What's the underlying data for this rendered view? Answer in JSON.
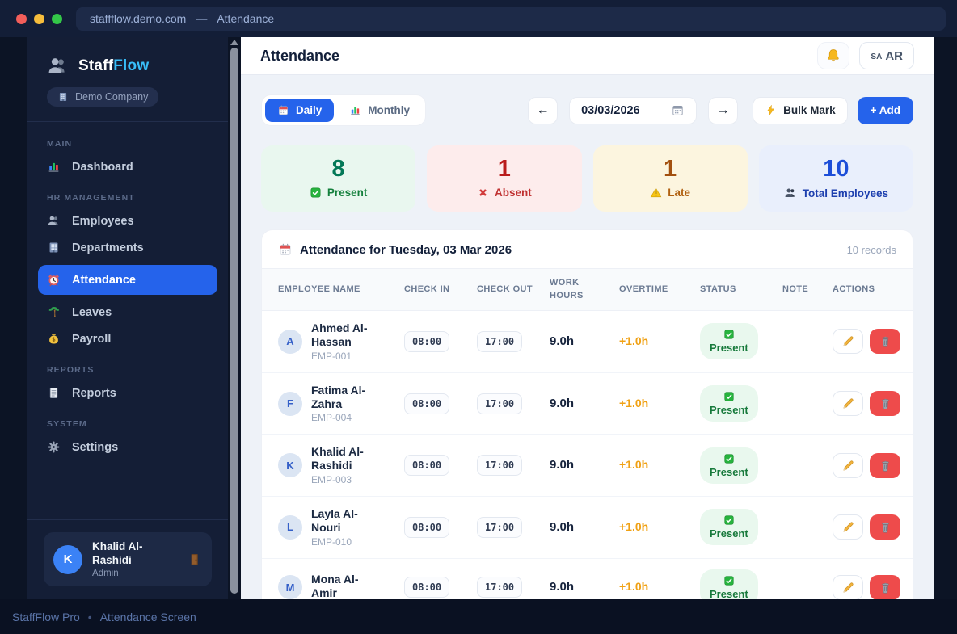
{
  "browser": {
    "url": "staffflow.demo.com",
    "separator": "—",
    "page_title": "Attendance"
  },
  "sidebar": {
    "brand": {
      "first": "Staff",
      "second": "Flow"
    },
    "company_badge": "Demo Company",
    "sections": [
      {
        "label": "MAIN",
        "items": [
          {
            "label": "Dashboard",
            "icon": "bar-chart-icon",
            "active": false
          }
        ]
      },
      {
        "label": "HR MANAGEMENT",
        "items": [
          {
            "label": "Employees",
            "icon": "people-icon",
            "active": false
          },
          {
            "label": "Departments",
            "icon": "building-icon",
            "active": false
          },
          {
            "label": "Attendance",
            "icon": "alarm-clock-icon",
            "active": true
          },
          {
            "label": "Leaves",
            "icon": "palm-tree-icon",
            "active": false
          },
          {
            "label": "Payroll",
            "icon": "money-bag-icon",
            "active": false
          }
        ]
      },
      {
        "label": "REPORTS",
        "items": [
          {
            "label": "Reports",
            "icon": "document-icon",
            "active": false
          }
        ]
      },
      {
        "label": "SYSTEM",
        "items": [
          {
            "label": "Settings",
            "icon": "gear-icon",
            "active": false
          }
        ]
      }
    ],
    "user": {
      "initial": "K",
      "name": "Khalid Al-Rashidi",
      "role": "Admin",
      "logout_icon": "door-icon"
    }
  },
  "header": {
    "title": "Attendance",
    "lang_small": "SA",
    "lang_large": "AR"
  },
  "toolbar": {
    "daily_label": "Daily",
    "monthly_label": "Monthly",
    "prev_label": "←",
    "date_value": "03/03/2026",
    "next_label": "→",
    "bulk_label": "Bulk Mark",
    "add_label": "+ Add"
  },
  "stats": [
    {
      "value": "8",
      "label": "Present",
      "icon": "green-check-icon",
      "bg": "#e9f7ef",
      "value_color": "#047857"
    },
    {
      "value": "1",
      "label": "Absent",
      "icon": "red-x-icon",
      "bg": "#fdecec",
      "value_color": "#b91c1c"
    },
    {
      "value": "1",
      "label": "Late",
      "icon": "warning-icon",
      "bg": "#fcf5df",
      "value_color": "#a2500f"
    },
    {
      "value": "10",
      "label": "Total Employees",
      "icon": "people-icon",
      "bg": "#e9effc",
      "value_color": "#1d4ed8"
    }
  ],
  "table": {
    "title": "Attendance for Tuesday, 03 Mar 2026",
    "records_label": "10 records",
    "columns": [
      "EMPLOYEE NAME",
      "CHECK IN",
      "CHECK OUT",
      "WORK HOURS",
      "OVERTIME",
      "STATUS",
      "NOTE",
      "ACTIONS"
    ],
    "rows": [
      {
        "initial": "A",
        "name": "Ahmed Al-Hassan",
        "emp_id": "EMP-001",
        "check_in": "08:00",
        "check_out": "17:00",
        "work_hours": "9.0h",
        "overtime": "+1.0h",
        "status": "Present",
        "note": ""
      },
      {
        "initial": "F",
        "name": "Fatima Al-Zahra",
        "emp_id": "EMP-004",
        "check_in": "08:00",
        "check_out": "17:00",
        "work_hours": "9.0h",
        "overtime": "+1.0h",
        "status": "Present",
        "note": ""
      },
      {
        "initial": "K",
        "name": "Khalid Al-Rashidi",
        "emp_id": "EMP-003",
        "check_in": "08:00",
        "check_out": "17:00",
        "work_hours": "9.0h",
        "overtime": "+1.0h",
        "status": "Present",
        "note": ""
      },
      {
        "initial": "L",
        "name": "Layla Al-Nouri",
        "emp_id": "EMP-010",
        "check_in": "08:00",
        "check_out": "17:00",
        "work_hours": "9.0h",
        "overtime": "+1.0h",
        "status": "Present",
        "note": ""
      },
      {
        "initial": "M",
        "name": "Mona Al-Amir",
        "emp_id": "",
        "check_in": "08:00",
        "check_out": "17:00",
        "work_hours": "9.0h",
        "overtime": "+1.0h",
        "status": "Present",
        "note": ""
      }
    ]
  },
  "footer": {
    "app": "StaffFlow Pro",
    "separator": "•",
    "screen": "Attendance Screen"
  },
  "colors": {
    "accent_blue": "#2563eb",
    "brand_highlight": "#38bdf8",
    "overtime_orange": "#f0a114",
    "present_green": "#15803d",
    "absent_red": "#b91c1c",
    "late_amber": "#b06010",
    "total_blue": "#1d4ed8",
    "delete_red": "#ee4b4b",
    "sidebar_bg": "#141e36",
    "frame_bg": "#0c1425"
  }
}
